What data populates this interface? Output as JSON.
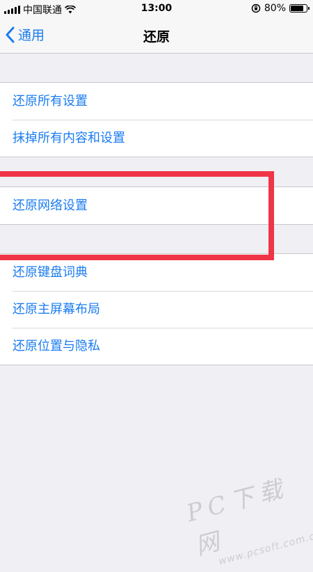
{
  "status_bar": {
    "carrier": "中国联通",
    "time": "13:00",
    "battery": "80%",
    "battery_level": 0.8,
    "icons": [
      "signal-icon",
      "wifi-icon",
      "rotation-lock-icon",
      "battery-icon"
    ]
  },
  "nav": {
    "back_label": "通用",
    "title": "还原",
    "back_icon": "chevron-left-icon"
  },
  "groups": [
    {
      "items": [
        {
          "label": "还原所有设置"
        },
        {
          "label": "抹掉所有内容和设置"
        }
      ]
    },
    {
      "items": [
        {
          "label": "还原网络设置"
        }
      ]
    },
    {
      "items": [
        {
          "label": "还原键盘词典"
        },
        {
          "label": "还原主屏幕布局"
        },
        {
          "label": "还原位置与隐私"
        }
      ]
    }
  ],
  "watermark": {
    "main": "PC下载网",
    "sub": "www.pcsoft.com.cn"
  },
  "colors": {
    "accent": "#1a7cf0",
    "highlight": "#ef3547",
    "background": "#efeff4"
  }
}
